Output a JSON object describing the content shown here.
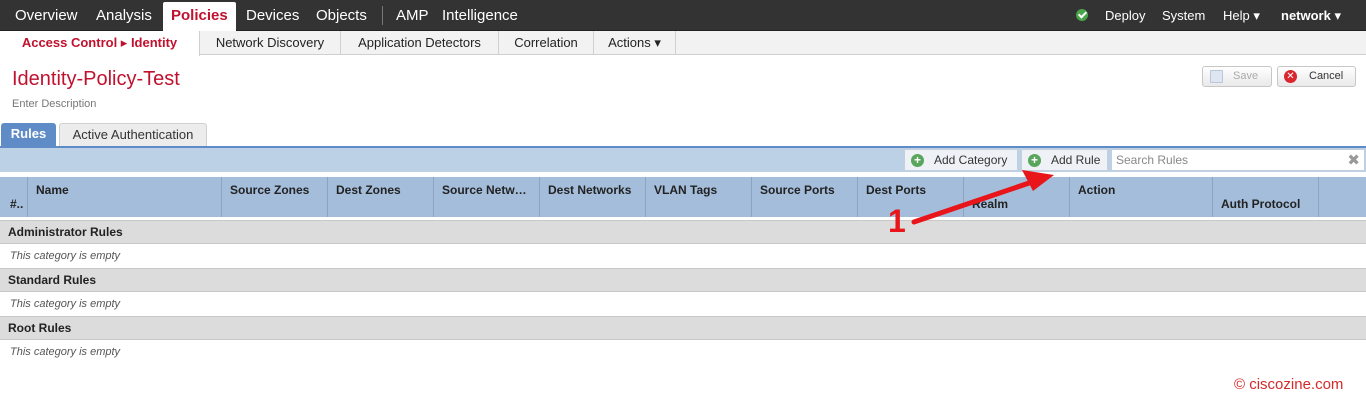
{
  "topnav": {
    "items": [
      "Overview",
      "Analysis",
      "Policies",
      "Devices",
      "Objects",
      "AMP",
      "Intelligence"
    ],
    "right": {
      "deploy": "Deploy",
      "system": "System",
      "help": "Help ▾",
      "user": "network ▾"
    },
    "status_icon": "check-circle-icon"
  },
  "subnav": {
    "items": [
      "Access Control ▸ Identity",
      "Network Discovery",
      "Application Detectors",
      "Correlation",
      "Actions ▾"
    ]
  },
  "page": {
    "title": "Identity-Policy-Test",
    "description": "Enter Description",
    "save_label": "Save",
    "cancel_label": "Cancel"
  },
  "tabs": [
    "Rules",
    "Active Authentication"
  ],
  "toolbar": {
    "add_category": "Add Category",
    "add_rule": "Add Rule",
    "search_placeholder": "Search Rules",
    "clear": "✖"
  },
  "table": {
    "headers": [
      "#..",
      "Name",
      "Source Zones",
      "Dest Zones",
      "Source Netw…",
      "Dest Networks",
      "VLAN Tags",
      "Source Ports",
      "Dest Ports",
      "Realm",
      "Action",
      "Auth Protocol"
    ]
  },
  "categories": [
    {
      "name": "Administrator Rules",
      "empty": "This category is empty"
    },
    {
      "name": "Standard Rules",
      "empty": "This category is empty"
    },
    {
      "name": "Root Rules",
      "empty": "This category is empty"
    }
  ],
  "annotation": {
    "number": "1",
    "color": "#e8161a"
  },
  "watermark": "© ciscozine.com",
  "colors": {
    "accent": "#c0112e",
    "tab_blue": "#5f8cc7",
    "header_blue": "#a4bddb",
    "toolbar_blue": "#bcd0e6"
  }
}
